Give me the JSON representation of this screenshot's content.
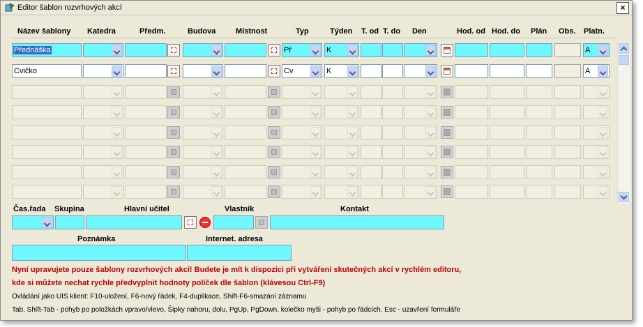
{
  "window": {
    "title": "Editor šablon rozvrhových akcí",
    "close_label": "×"
  },
  "columns": [
    "Název šablony",
    "Katedra",
    "Předm.",
    "Budova",
    "Místnost",
    "Typ",
    "Týden",
    "T. od",
    "T. do",
    "Den",
    "Hod. od",
    "Hod. do",
    "Plán",
    "Obs.",
    "Platn."
  ],
  "rows": [
    {
      "nazev": "Přednáška",
      "katedra": "",
      "predm": "",
      "budova": "",
      "mistnost": "",
      "typ": "Př",
      "tyden": "K",
      "t_od": "",
      "t_do": "",
      "den": "",
      "hod_od": "",
      "hod_do": "",
      "plan": "",
      "obs": "",
      "platn": "A"
    },
    {
      "nazev": "Cvičko",
      "katedra": "",
      "predm": "",
      "budova": "",
      "mistnost": "",
      "typ": "Cv",
      "tyden": "K",
      "t_od": "",
      "t_do": "",
      "den": "",
      "hod_od": "",
      "hod_do": "",
      "plan": "",
      "obs": "",
      "platn": "A"
    }
  ],
  "empty_row_count": 6,
  "form": {
    "cas_rada_label": "Čas.řada",
    "skupina_label": "Skupina",
    "hlavni_ucitel_label": "Hlavní učitel",
    "vlastnik_label": "Vlastník",
    "kontakt_label": "Kontakt",
    "poznamka_label": "Poznámka",
    "internet_adresa_label": "Internet. adresa",
    "cas_rada_value": "",
    "skupina_value": "",
    "hlavni_ucitel_value": "",
    "vlastnik_value": "",
    "kontakt_value": "",
    "poznamka_value": "",
    "internet_adresa_value": ""
  },
  "messages": {
    "warning_line1": "Nyní upravujete pouze šablony rozvrhových akcí! Budete je mít k dispozici při vytváření skutečných akcí v rychlém editoru,",
    "warning_line2": "kde si můžete nechat rychle předvyplnit hodnoty políček dle šablon (klávesou Ctrl-F9)",
    "help_line1": "Ovládání jako UIS klient: F10-uložení, F6-nový řádek, F4-duplikace, Shift-F6-smazání záznamu",
    "help_line2": "Tab, Shift-Tab - pohyb po položkách vpravo/vlevo, Šipky nahoru, dolu, PgUp, PgDown, kolečko myši - pohyb po řádcích. Esc - uzavření formuláře"
  },
  "colors": {
    "field_required": "#6ff7ff",
    "warning_text": "#c00000",
    "selection": "#316ac5"
  }
}
